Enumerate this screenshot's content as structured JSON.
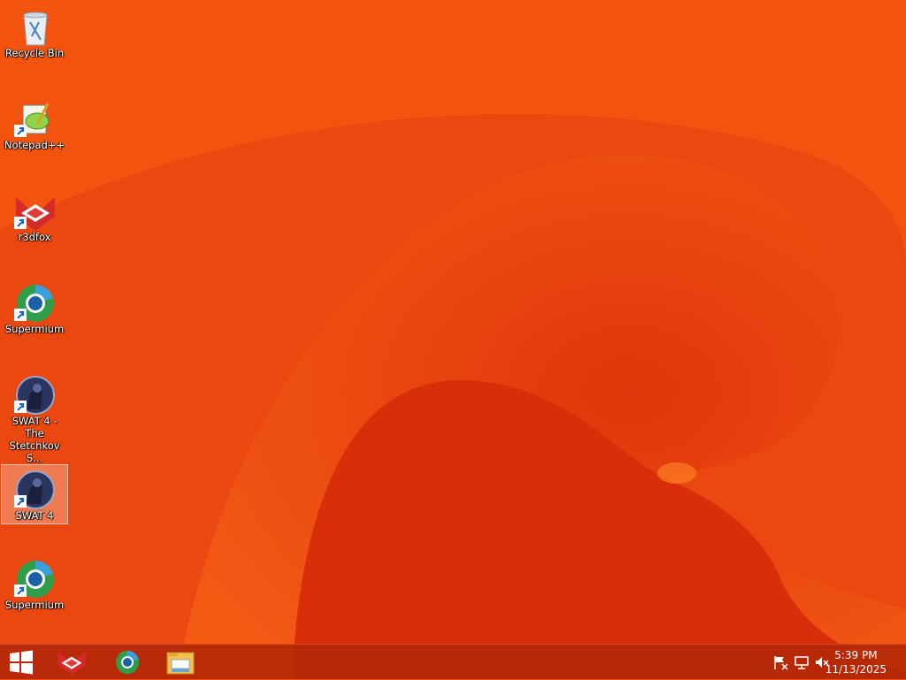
{
  "desktop": {
    "icons": [
      {
        "label": "Recycle Bin",
        "icon": "recycle-bin-icon"
      },
      {
        "label": "Notepad++",
        "icon": "notepad-plus-plus-icon"
      },
      {
        "label": "r3dfox",
        "icon": "r3dfox-icon"
      },
      {
        "label": "Supermium",
        "icon": "supermium-icon"
      },
      {
        "label": "SWAT 4 - The Stetchkov S...",
        "icon": "swat4-icon"
      },
      {
        "label": "SWAT 4",
        "icon": "swat4-icon",
        "selected": true
      },
      {
        "label": "Supermium",
        "icon": "supermium-icon"
      }
    ]
  },
  "taskbar": {
    "pinned": [
      "r3dfox-icon",
      "supermium-icon",
      "file-explorer-icon"
    ],
    "tray": [
      "action-center-flag-icon",
      "network-icon",
      "volume-muted-icon"
    ],
    "clock": {
      "time": "5:39 PM",
      "date": "11/13/2025"
    }
  },
  "colors": {
    "wallpaper": "#ee4a10",
    "taskbar": "#b4280a",
    "selection": "#f29b82"
  }
}
